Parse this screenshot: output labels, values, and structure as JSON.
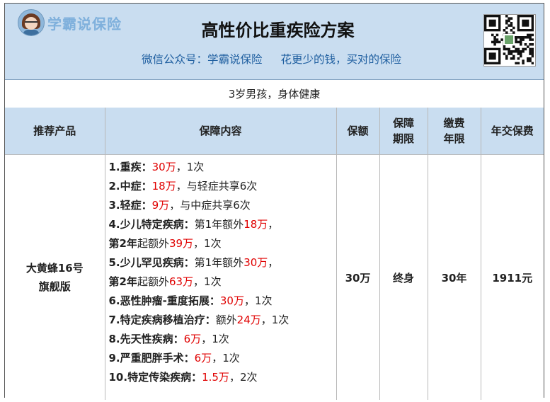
{
  "header": {
    "brand": "学霸说保险",
    "title": "高性价比重疾险方案",
    "wechat": "微信公众号：学霸说保险",
    "slogan": "花更少的钱，买对的保险"
  },
  "profile": "3岁男孩，身体健康",
  "table": {
    "headers": {
      "product": "推荐产品",
      "coverage": "保障内容",
      "amount": "保额",
      "term_line1": "保障",
      "term_line2": "期限",
      "payment_line1": "缴费",
      "payment_line2": "年限",
      "premium": "年交保费"
    },
    "row": {
      "product_line1": "大黄蜂16号",
      "product_line2": "旗舰版",
      "amount": "30万",
      "term": "终身",
      "payment": "30年",
      "premium": "1911元",
      "coverage": [
        {
          "label": "1.重疾：",
          "value": "30万",
          "rest": "，1次"
        },
        {
          "label": "2.中症：",
          "value": "18万",
          "rest": "，与轻症共享6次"
        },
        {
          "label": "3.轻症：",
          "value": "9万",
          "rest": "，与中症共享6次"
        },
        {
          "label": "4.少儿特定疾病：",
          "pre": "第1年额外",
          "value": "18万",
          "rest": "，"
        },
        {
          "label": "第2年",
          "pre": "起额外",
          "value": "39万",
          "rest": "，1次"
        },
        {
          "label": "5.少儿罕见疾病：",
          "pre": "第1年额外",
          "value": "30万",
          "rest": "，"
        },
        {
          "label": "第2年",
          "pre": "起额外",
          "value": "63万",
          "rest": "，1次"
        },
        {
          "label": "6.恶性肿瘤-重度拓展：",
          "value": "30万",
          "rest": "，1次"
        },
        {
          "label": "7.特定疾病移植治疗：",
          "pre": "额外",
          "value": "24万",
          "rest": "，1次"
        },
        {
          "label": "8.先天性疾病：",
          "value": "6万",
          "rest": "，1次"
        },
        {
          "label": "9.严重肥胖手术：",
          "value": "6万",
          "rest": "，1次"
        },
        {
          "label": "10.特定传染疾病：",
          "value": "1.5万",
          "rest": "，2次"
        }
      ]
    }
  },
  "icons": {
    "logo": "girl-avatar-icon",
    "qr": "qr-code-icon"
  },
  "colors": {
    "header_bg": "#c9ddf0",
    "accent_text": "#1f5fa0",
    "highlight": "#e00000"
  }
}
